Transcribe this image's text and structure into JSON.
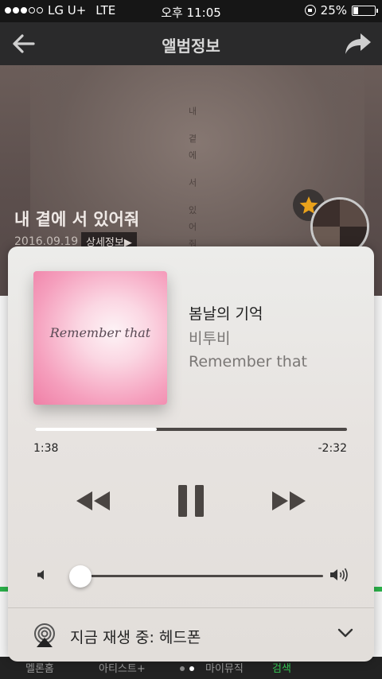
{
  "status_bar": {
    "carrier": "LG U+",
    "network": "LTE",
    "time": "오후 11:05",
    "battery": "25%"
  },
  "header": {
    "title": "앨범정보"
  },
  "album": {
    "title": "내 곁에 서 있어줘",
    "date": "2016.09.19",
    "detail_label": "상세정보▶",
    "vertical_text": "내 곁에 서 있어줘"
  },
  "now_playing": {
    "song_title": "봄날의 기억",
    "artist": "비투비",
    "album": "Remember that",
    "cover_text": "Remember that",
    "elapsed": "1:38",
    "remaining": "-2:32",
    "progress": 0.39,
    "volume": 0.04,
    "route_label": "지금 재생 중: 헤드폰"
  },
  "bottom_nav": {
    "items": [
      "멜론홈",
      "아티스트+",
      "마이뮤직",
      "검색"
    ],
    "active_index": 3
  },
  "colors": {
    "accent_green": "#35c653",
    "panel_bg": "#e7e3e0",
    "header_bg": "#2a2a2b"
  },
  "icons": [
    "back-arrow-icon",
    "share-icon",
    "star-icon",
    "rewind-icon",
    "pause-icon",
    "fast-forward-icon",
    "volume-low-icon",
    "volume-high-icon",
    "airplay-icon",
    "chevron-down-icon"
  ]
}
